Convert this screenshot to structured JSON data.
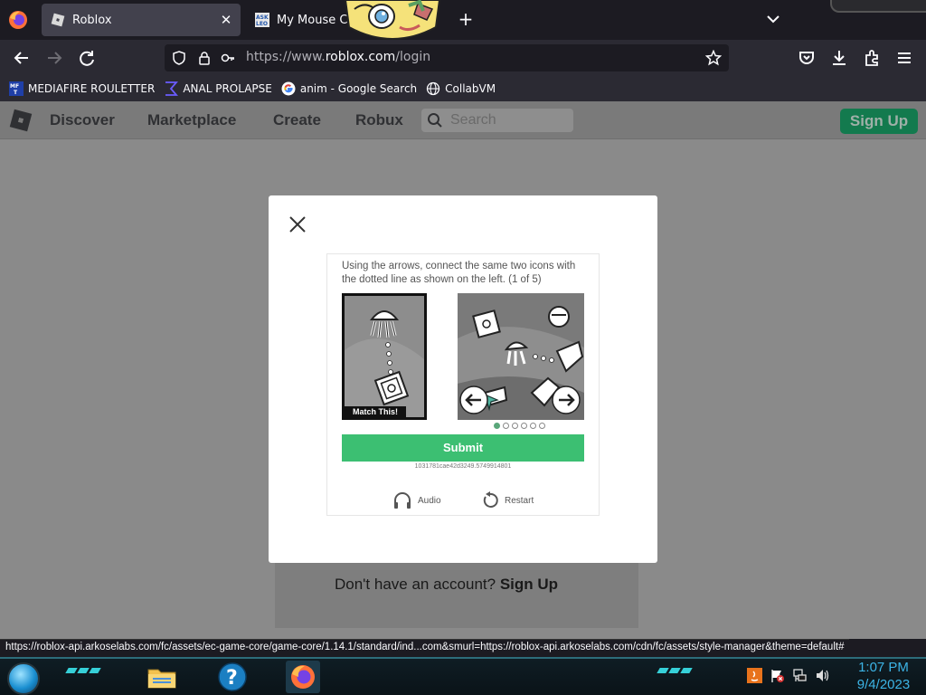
{
  "browser": {
    "tabs": [
      {
        "title": "Roblox",
        "active": true
      },
      {
        "title": "My Mouse Cu",
        "active": false
      }
    ],
    "address_bar": {
      "url_prefix": "https://www.",
      "url_domain": "roblox.com",
      "url_path": "/login"
    },
    "bookmarks": [
      {
        "label": "MEDIAFIRE ROULETTER",
        "icon": "mediafire-icon"
      },
      {
        "label": "ANAL PROLAPSE",
        "icon": "sigma-icon"
      },
      {
        "label": "anim - Google Search",
        "icon": "google-icon"
      },
      {
        "label": "CollabVM",
        "icon": "globe-icon"
      }
    ],
    "status_url": "https://roblox-api.arkoselabs.com/fc/assets/ec-game-core/game-core/1.14.1/standard/ind...com&smurl=https://roblox-api.arkoselabs.com/cdn/fc/assets/style-manager&theme=default#"
  },
  "roblox": {
    "nav": [
      "Discover",
      "Marketplace",
      "Create",
      "Robux"
    ],
    "search_placeholder": "Search",
    "signup_button": "Sign Up",
    "signup_prompt_text": "Don't have an account?",
    "signup_prompt_link": "Sign Up"
  },
  "captcha": {
    "instruction": "Using the arrows, connect the same two icons with the dotted line as shown on the left. (1 of 5)",
    "match_label": "Match This!",
    "submit_label": "Submit",
    "session_id": "1031781cae42d3249.5749914801",
    "audio_label": "Audio",
    "restart_label": "Restart",
    "progress_total": 6,
    "progress_current": 1
  },
  "taskbar": {
    "time": "1:07 PM",
    "date": "9/4/2023"
  },
  "colors": {
    "accent_green": "#3cbf72",
    "roblox_signup": "#137a4e",
    "clock_blue": "#3cb4e6"
  }
}
